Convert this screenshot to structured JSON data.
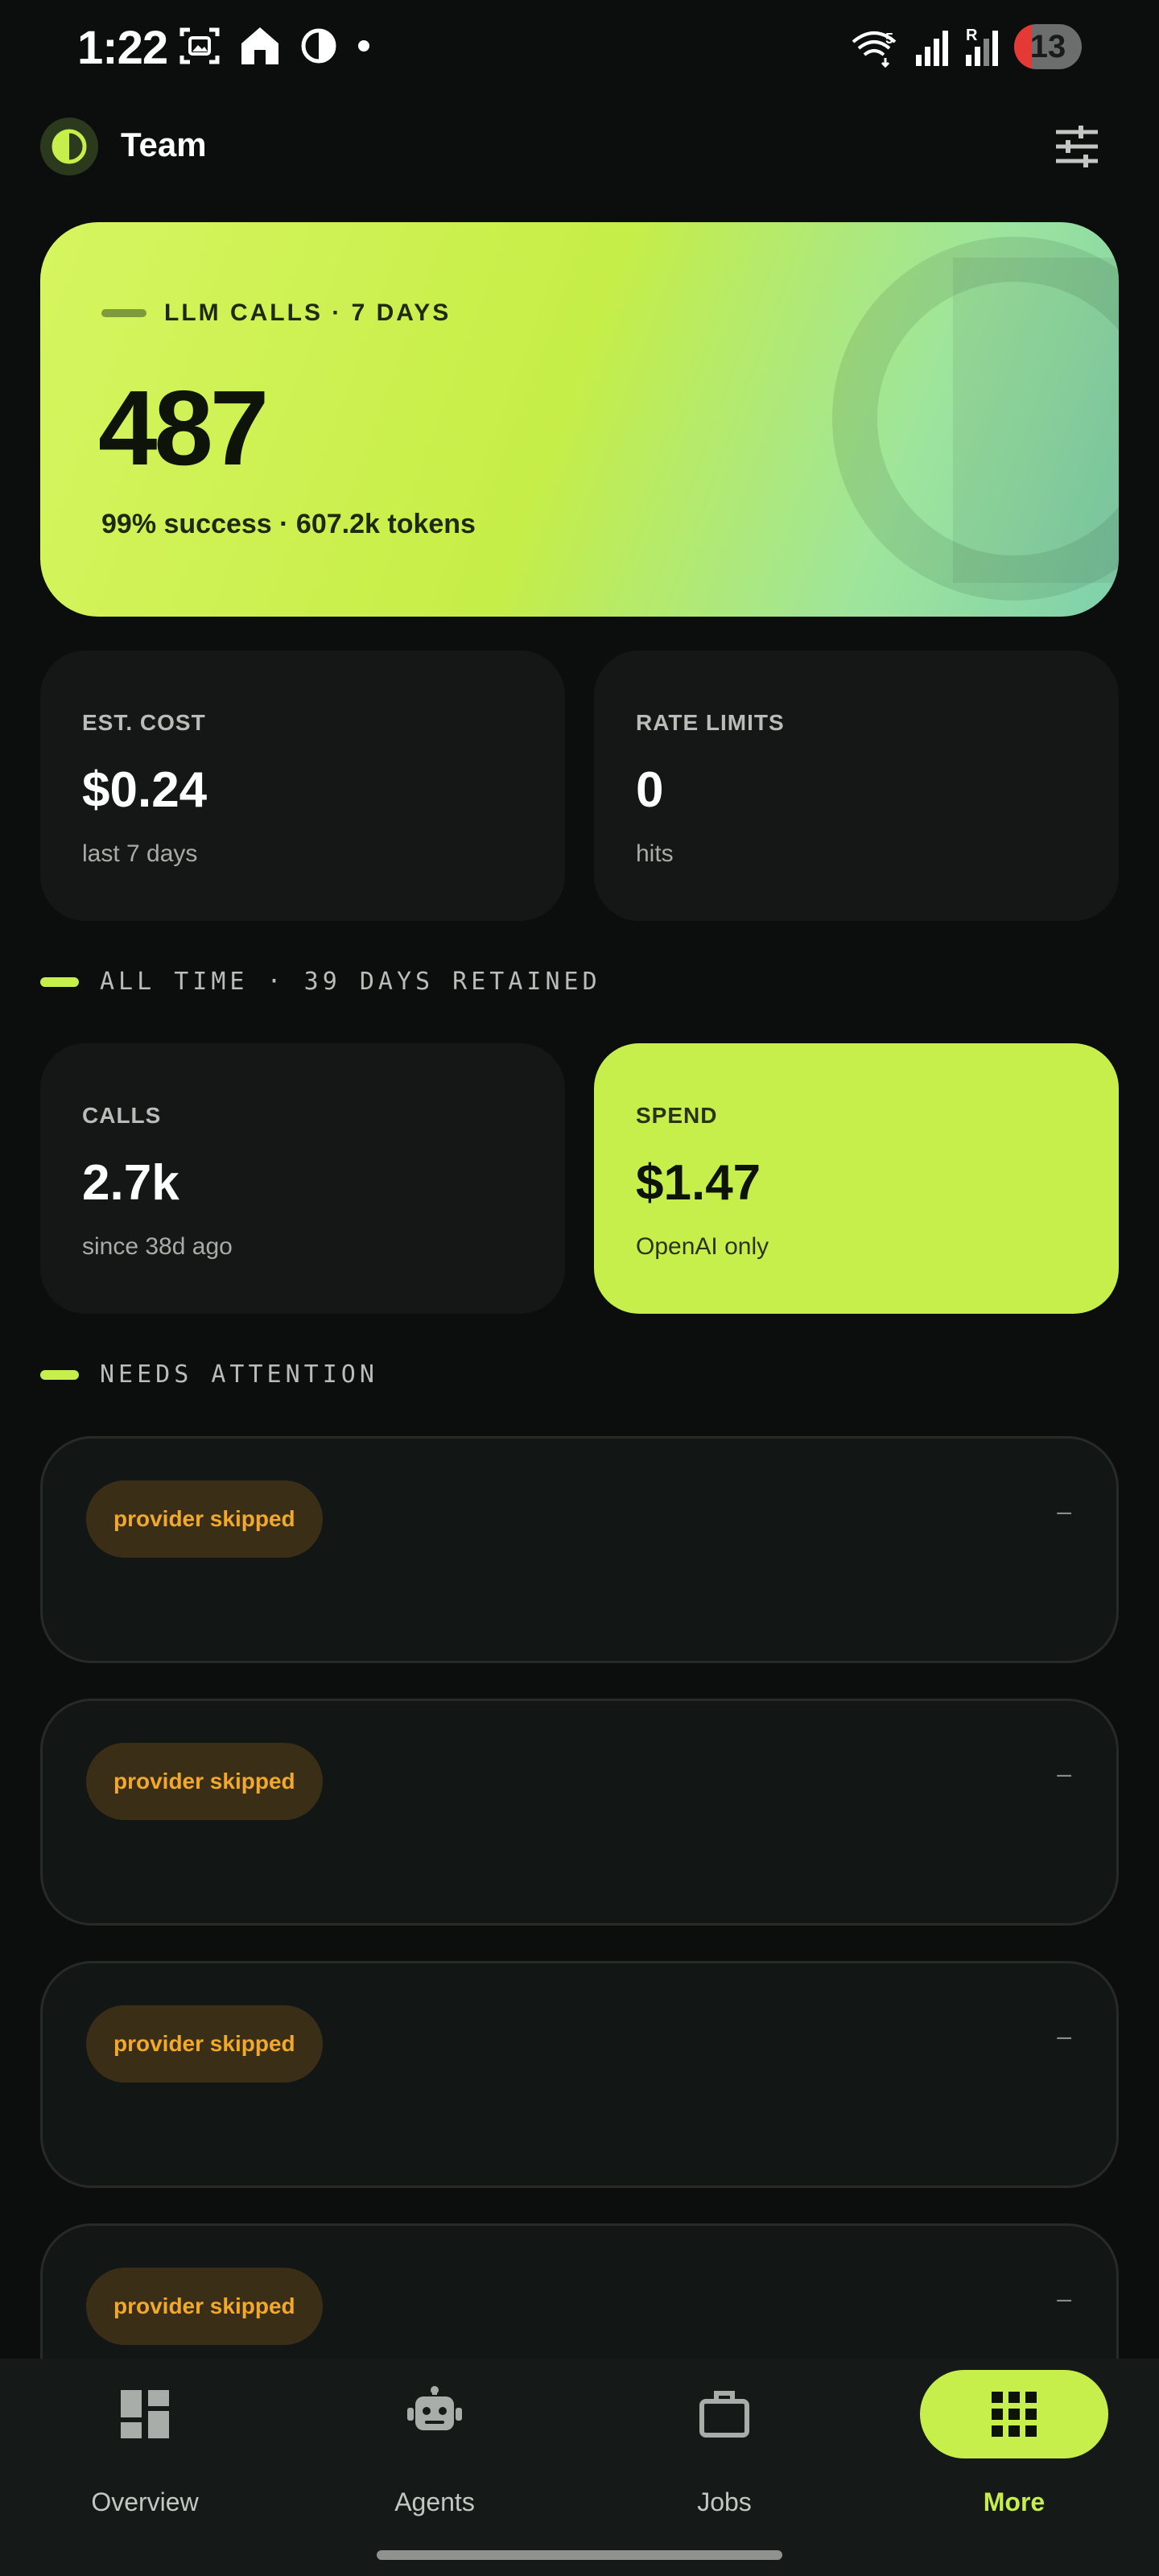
{
  "status_bar": {
    "time": "1:22",
    "wifi_label": "5",
    "roaming_label": "R",
    "battery_level": "13"
  },
  "header": {
    "title": "Team",
    "logo_icon": "half-circle-icon",
    "filter_icon": "sliders-icon"
  },
  "hero": {
    "eyebrow": "LLM CALLS · 7 DAYS",
    "value": "487",
    "subtitle": "99% success · 607.2k tokens"
  },
  "stats": [
    {
      "label": "EST. COST",
      "value": "$0.24",
      "sub": "last 7 days"
    },
    {
      "label": "RATE LIMITS",
      "value": "0",
      "sub": "hits"
    }
  ],
  "all_time": {
    "section_label": "ALL TIME · 39 DAYS RETAINED",
    "cards": [
      {
        "label": "CALLS",
        "value": "2.7k",
        "sub": "since 38d ago"
      },
      {
        "label": "SPEND",
        "value": "$1.47",
        "sub": "OpenAI only"
      }
    ]
  },
  "attention": {
    "section_label": "NEEDS ATTENTION",
    "items": [
      {
        "chip": "provider skipped",
        "meta": "–"
      },
      {
        "chip": "provider skipped",
        "meta": "–"
      },
      {
        "chip": "provider skipped",
        "meta": "–"
      },
      {
        "chip": "provider skipped",
        "meta": "–"
      }
    ]
  },
  "nav": [
    {
      "label": "Overview",
      "icon": "dashboard-icon",
      "active": false
    },
    {
      "label": "Agents",
      "icon": "robot-icon",
      "active": false
    },
    {
      "label": "Jobs",
      "icon": "briefcase-icon",
      "active": false
    },
    {
      "label": "More",
      "icon": "grid-icon",
      "active": true
    }
  ],
  "colors": {
    "accent": "#c6ef4b",
    "background": "#0b0e0d",
    "card": "#141715",
    "chip_bg": "#3a2e17",
    "chip_text": "#f2a92a"
  }
}
